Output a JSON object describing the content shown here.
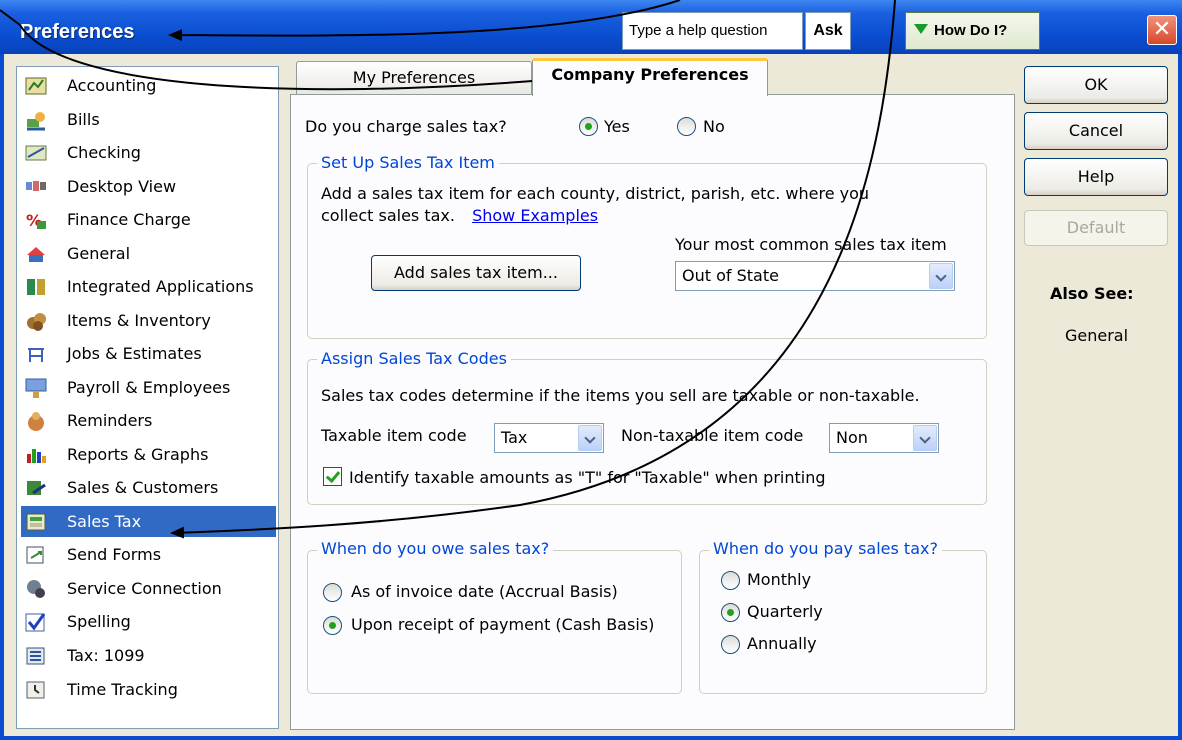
{
  "window": {
    "title": "Preferences",
    "help_placeholder": "Type a help question",
    "ask_label": "Ask",
    "how_do_i_label": "How Do I?",
    "close_glyph": "✕"
  },
  "sidebar": {
    "selected_index": 15,
    "items": [
      {
        "label": "Accounting",
        "icon": "accounting-icon"
      },
      {
        "label": "Bills",
        "icon": "bills-icon"
      },
      {
        "label": "Checking",
        "icon": "checking-icon"
      },
      {
        "label": "Desktop View",
        "icon": "desktop-view-icon"
      },
      {
        "label": "Finance Charge",
        "icon": "finance-charge-icon"
      },
      {
        "label": "General",
        "icon": "general-icon"
      },
      {
        "label": "Integrated Applications",
        "icon": "integrated-applications-icon"
      },
      {
        "label": "Items & Inventory",
        "icon": "items-inventory-icon"
      },
      {
        "label": "Jobs & Estimates",
        "icon": "jobs-estimates-icon"
      },
      {
        "label": "Payroll & Employees",
        "icon": "payroll-employees-icon"
      },
      {
        "label": "Reminders",
        "icon": "reminders-icon"
      },
      {
        "label": "Reports & Graphs",
        "icon": "reports-graphs-icon"
      },
      {
        "label": "Sales & Customers",
        "icon": "sales-customers-icon"
      },
      {
        "label": "Sales Tax",
        "icon": "sales-tax-icon"
      },
      {
        "label": "Send Forms",
        "icon": "send-forms-icon"
      },
      {
        "label": "Service Connection",
        "icon": "service-connection-icon"
      },
      {
        "label": "Spelling",
        "icon": "spelling-icon"
      },
      {
        "label": "Tax: 1099",
        "icon": "tax-1099-icon"
      },
      {
        "label": "Time Tracking",
        "icon": "time-tracking-icon"
      }
    ]
  },
  "tabs": {
    "my_preferences": "My Preferences",
    "company_preferences": "Company Preferences",
    "active": "company_preferences"
  },
  "sales_tax": {
    "question": "Do you charge sales tax?",
    "yes_label": "Yes",
    "no_label": "No",
    "charge_sales_tax": "Yes",
    "setup_group": {
      "title": "Set Up Sales Tax Item",
      "description_line1": "Add a sales tax item for each county, district, parish, etc. where you",
      "description_line2": "collect sales tax.",
      "show_examples": "Show Examples",
      "add_button": "Add sales tax item...",
      "common_item_label": "Your most common sales tax item",
      "common_item_value": "Out of State"
    },
    "codes_group": {
      "title": "Assign Sales Tax Codes",
      "description": "Sales tax codes determine if the items you sell are taxable or non-taxable.",
      "taxable_label": "Taxable item code",
      "taxable_value": "Tax",
      "nontaxable_label": "Non-taxable item code",
      "nontaxable_value": "Non",
      "identify_label": "Identify taxable amounts as \"T\" for \"Taxable\" when printing",
      "identify_checked": true
    },
    "owe_group": {
      "title": "When do you owe sales tax?",
      "options": [
        "As of invoice date (Accrual Basis)",
        "Upon receipt of payment (Cash Basis)"
      ],
      "selected": "Upon receipt of payment (Cash Basis)"
    },
    "pay_group": {
      "title": "When do you pay sales tax?",
      "options": [
        "Monthly",
        "Quarterly",
        "Annually"
      ],
      "selected": "Quarterly"
    }
  },
  "buttons": {
    "ok": "OK",
    "cancel": "Cancel",
    "help": "Help",
    "default": "Default"
  },
  "also_see": {
    "title": "Also See:",
    "link": "General"
  },
  "colors": {
    "title_bar": "#0a4ccf",
    "selection": "#316ac5",
    "group_title": "#0046d5",
    "client_bg": "#ece9d8"
  }
}
